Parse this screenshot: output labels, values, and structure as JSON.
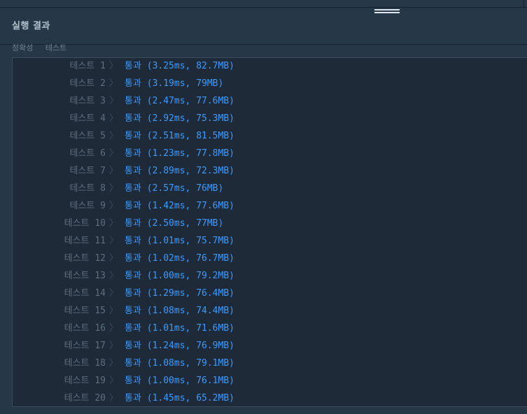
{
  "panel": {
    "title": "실행 결과",
    "section_labels": [
      "정확성",
      "테스트"
    ]
  },
  "results": [
    {
      "label": "테스트 1",
      "status": "통과",
      "detail": "(3.25ms, 82.7MB)"
    },
    {
      "label": "테스트 2",
      "status": "통과",
      "detail": "(3.19ms, 79MB)"
    },
    {
      "label": "테스트 3",
      "status": "통과",
      "detail": "(2.47ms, 77.6MB)"
    },
    {
      "label": "테스트 4",
      "status": "통과",
      "detail": "(2.92ms, 75.3MB)"
    },
    {
      "label": "테스트 5",
      "status": "통과",
      "detail": "(2.51ms, 81.5MB)"
    },
    {
      "label": "테스트 6",
      "status": "통과",
      "detail": "(1.23ms, 77.8MB)"
    },
    {
      "label": "테스트 7",
      "status": "통과",
      "detail": "(2.89ms, 72.3MB)"
    },
    {
      "label": "테스트 8",
      "status": "통과",
      "detail": "(2.57ms, 76MB)"
    },
    {
      "label": "테스트 9",
      "status": "통과",
      "detail": "(1.42ms, 77.6MB)"
    },
    {
      "label": "테스트 10",
      "status": "통과",
      "detail": "(2.50ms, 77MB)"
    },
    {
      "label": "테스트 11",
      "status": "통과",
      "detail": "(1.01ms, 75.7MB)"
    },
    {
      "label": "테스트 12",
      "status": "통과",
      "detail": "(1.02ms, 76.7MB)"
    },
    {
      "label": "테스트 13",
      "status": "통과",
      "detail": "(1.00ms, 79.2MB)"
    },
    {
      "label": "테스트 14",
      "status": "통과",
      "detail": "(1.29ms, 76.4MB)"
    },
    {
      "label": "테스트 15",
      "status": "통과",
      "detail": "(1.08ms, 74.4MB)"
    },
    {
      "label": "테스트 16",
      "status": "통과",
      "detail": "(1.01ms, 71.6MB)"
    },
    {
      "label": "테스트 17",
      "status": "통과",
      "detail": "(1.24ms, 76.9MB)"
    },
    {
      "label": "테스트 18",
      "status": "통과",
      "detail": "(1.08ms, 79.1MB)"
    },
    {
      "label": "테스트 19",
      "status": "통과",
      "detail": "(1.00ms, 76.1MB)"
    },
    {
      "label": "테스트 20",
      "status": "통과",
      "detail": "(1.45ms, 65.2MB)"
    }
  ],
  "icons": {
    "chevron": "chevron-right-icon",
    "drag_handle": "drag-handle-icon"
  },
  "colors": {
    "pass": "#3a9bff",
    "label": "#5d6e7e",
    "background": "#1e2a38"
  }
}
